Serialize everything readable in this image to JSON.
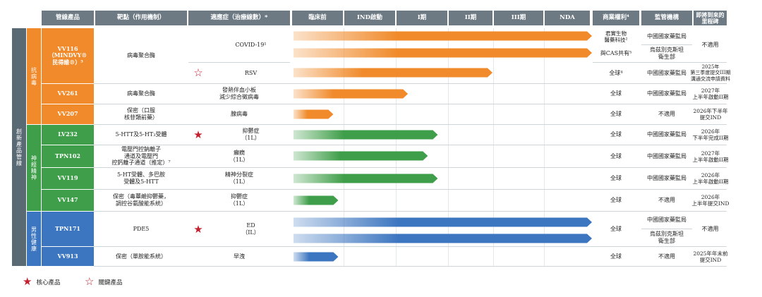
{
  "headers": {
    "product": "管線產品",
    "target": "靶點（作用機制）",
    "indication": "適應症（治療線數）*",
    "preclinical": "臨床前",
    "ind": "IND啟動",
    "phase1": "I期",
    "phase2": "II期",
    "phase3": "III期",
    "nda": "NDA",
    "rights": "商業權利⁴",
    "regulator": "監管機構",
    "milestone": "即將到來的\n里程碑"
  },
  "groups": {
    "main": "創新產品管線",
    "infectious": "抗病毒",
    "cns": "神經精神",
    "mens": "男性健康"
  },
  "rows": [
    {
      "product": "VV116\n（MINDVY®\n民得維®）³",
      "target": "病毒聚合酶",
      "indication": "COVID-19¹",
      "rights": "君實生物\n醫藥科技²",
      "regulator": "中國國家藥監局",
      "milestone": "不適用"
    },
    {
      "product": "",
      "target": "",
      "indication": "",
      "rights": "與CAS共有⁵",
      "regulator": "烏茲別克斯坦\n衛生部",
      "milestone": ""
    },
    {
      "product": "",
      "target": "",
      "indication": "RSV",
      "rights": "全球⁴",
      "regulator": "中國國家藥監局",
      "milestone": "2025年\n第三季度提交III期\n溝通交流申請資料"
    },
    {
      "product": "VV261",
      "target": "病毒聚合酶",
      "indication": "發熱伴血小板\n減少綜合徵病毒",
      "rights": "全球",
      "regulator": "中國國家藥監局",
      "milestone": "2027年\n上半年啟動II期"
    },
    {
      "product": "VV207",
      "target": "保密（口服\n核苷類前藥）",
      "indication": "腺病毒",
      "rights": "全球",
      "regulator": "不適用",
      "milestone": "2026年下半年\n提交IND"
    },
    {
      "product": "LV232",
      "target": "5-HTT及5-HT₃受體",
      "indication": "抑鬱症\n（1L）",
      "rights": "全球",
      "regulator": "中國國家藥監局",
      "milestone": "2026年\n下半年完成II期"
    },
    {
      "product": "TPN102",
      "target": "電壓門控鈉離子\n通道及電壓門\n控鈣離子通道（推定）⁷",
      "indication": "癲癇\n（1L）",
      "rights": "全球",
      "regulator": "中國國家藥監局",
      "milestone": "2027年\n上半年啟動II期"
    },
    {
      "product": "VV119",
      "target": "5-HT受體、多巴胺\n受體及5-HTT",
      "indication": "精神分裂症\n（1L）",
      "rights": "全球",
      "regulator": "中國國家藥監局",
      "milestone": "2026年\n上半年啟動II期"
    },
    {
      "product": "VV147",
      "target": "保密（毒蕈鹼抑鬱藥，\n調控谷氨酸能系統）",
      "indication": "抑鬱症\n（1L）",
      "rights": "全球",
      "regulator": "不適用",
      "milestone": "2026年\n上半年提交IND"
    },
    {
      "product": "TPN171",
      "target": "PDE5",
      "indication": "ED\n（IL）",
      "rights": "全球",
      "regulator": "中國國家藥監局",
      "milestone": "不適用"
    },
    {
      "product": "",
      "target": "",
      "indication": "",
      "rights": "",
      "regulator": "烏茲別克斯坦\n衛生部",
      "milestone": ""
    },
    {
      "product": "VV913",
      "target": "保密（單胺能系統）",
      "indication": "早洩",
      "rights": "全球",
      "regulator": "不適用",
      "milestone": "2025年年末前\n提交IND"
    }
  ],
  "chart_data": {
    "type": "bar",
    "orientation": "horizontal",
    "stages": [
      "臨床前",
      "IND啟動",
      "I期",
      "II期",
      "III期",
      "NDA"
    ],
    "series": [
      {
        "product": "VV116",
        "indication": "COVID-19",
        "stage_progress": 6.0,
        "color": "#f08a2a"
      },
      {
        "product": "VV116",
        "indication": "COVID-19",
        "stage_progress": 6.0,
        "color": "#f08a2a"
      },
      {
        "product": "VV116",
        "indication": "RSV",
        "stage_progress": 4.0,
        "color": "#f08a2a"
      },
      {
        "product": "VV261",
        "indication": "發熱伴血小板減少綜合徵病毒",
        "stage_progress": 2.3,
        "color": "#f08a2a"
      },
      {
        "product": "VV207",
        "indication": "腺病毒",
        "stage_progress": 0.8,
        "color": "#f08a2a"
      },
      {
        "product": "LV232",
        "indication": "抑鬱症",
        "stage_progress": 2.9,
        "color": "#3f9e49"
      },
      {
        "product": "TPN102",
        "indication": "癲癇",
        "stage_progress": 2.7,
        "color": "#3f9e49"
      },
      {
        "product": "VV119",
        "indication": "精神分裂症",
        "stage_progress": 2.9,
        "color": "#3f9e49"
      },
      {
        "product": "VV147",
        "indication": "抑鬱症",
        "stage_progress": 0.9,
        "color": "#3f9e49"
      },
      {
        "product": "TPN171",
        "indication": "ED",
        "stage_progress": 6.0,
        "color": "#3d76c0"
      },
      {
        "product": "TPN171",
        "indication": "ED",
        "stage_progress": 6.0,
        "color": "#3d76c0"
      },
      {
        "product": "VV913",
        "indication": "早洩",
        "stage_progress": 0.9,
        "color": "#3d76c0"
      }
    ]
  },
  "legend": {
    "core": "核心產品",
    "key": "關鍵產品"
  },
  "colors": {
    "header": "#6d7a83",
    "group": "#5a6a74",
    "antiviral": "#f08a2a",
    "neuro": "#3f9e49",
    "mens": "#3d76c0",
    "star": "#c2202e"
  }
}
